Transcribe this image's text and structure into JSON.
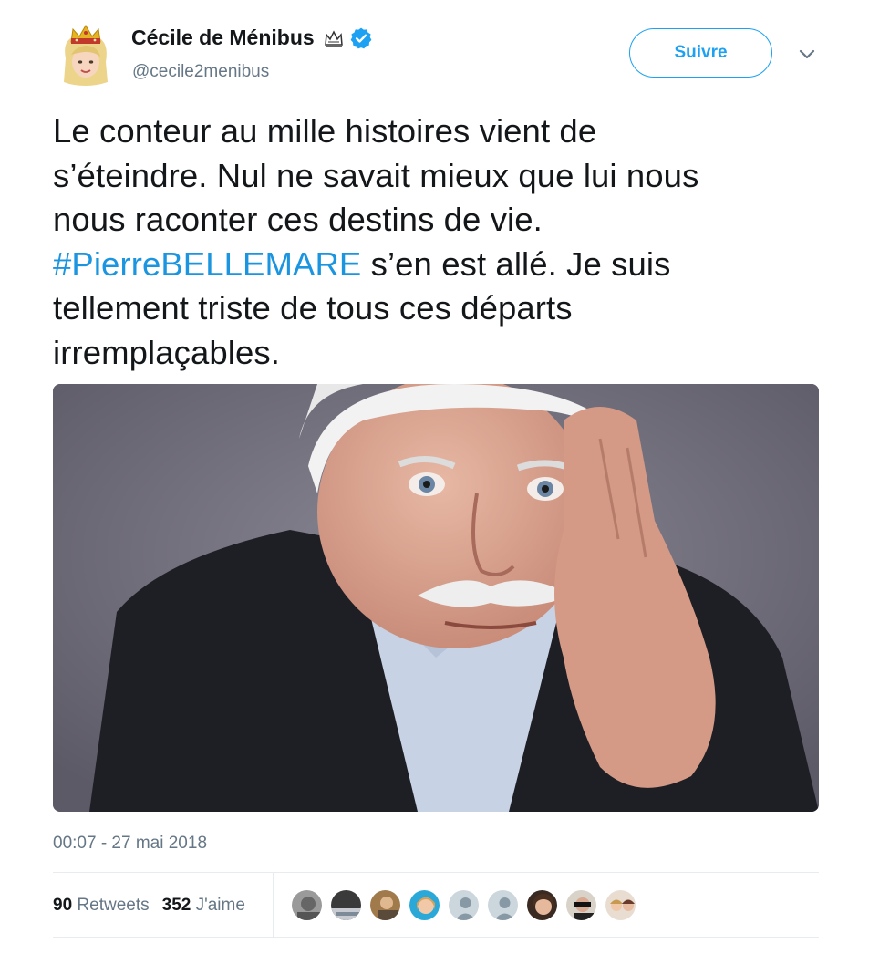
{
  "author": {
    "name": "Cécile de Ménibus",
    "handle": "@cecile2menibus",
    "avatar_icon": "bitmoji-avatar-crown",
    "crown_icon": "crown-emoji",
    "verified_icon": "verified-badge-icon"
  },
  "actions": {
    "follow_label": "Suivre",
    "menu_icon": "chevron-down-icon"
  },
  "tweet": {
    "line1": "Le conteur au mille histoires vient de",
    "line2": "s’éteindre. Nul ne savait mieux que lui nous",
    "line3": "nous raconter ces destins de vie.",
    "hashtag": "#PierreBELLEMARE",
    "line4_rest": " s’en est allé. Je suis",
    "line5": "tellement triste de tous ces départs",
    "line6": "irremplaçables."
  },
  "timestamp": "00:07 - 27 mai 2018",
  "stats": {
    "retweets_count": "90",
    "retweets_label": "Retweets",
    "likes_count": "352",
    "likes_label": "J'aime"
  },
  "colors": {
    "accent": "#1da1f2",
    "hashtag": "#1b95e0",
    "muted": "#657786",
    "text": "#14171a"
  }
}
